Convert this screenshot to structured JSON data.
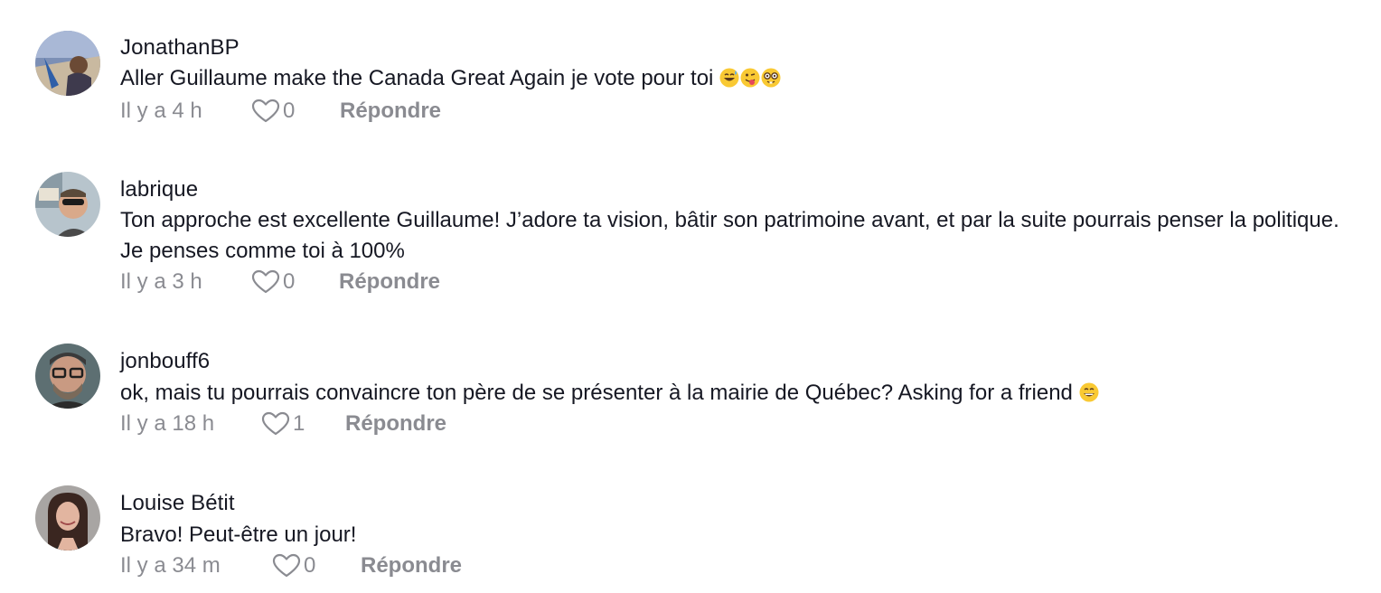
{
  "reply_label": "Répondre",
  "comments": [
    {
      "username": "JonathanBP",
      "text": "Aller Guillaume make the Canada Great Again je vote pour toi",
      "emojis": [
        "grinning-sweat-emoji",
        "winking-tongue-emoji",
        "nerd-glasses-emoji"
      ],
      "time": "Il y a 4 h",
      "likes": "0"
    },
    {
      "username": "labrique",
      "text": "Ton approche est excellente Guillaume! J’adore ta vision, bâtir son patrimoine avant, et par la suite pourrais penser la politique. Je penses comme toi à 100%",
      "time": "Il y a 3 h",
      "likes": "0"
    },
    {
      "username": "jonbouff6",
      "text": "ok, mais tu pourrais convaincre ton père de se présenter à la mairie de Québec? Asking for a friend",
      "emojis": [
        "grinning-emoji"
      ],
      "time": "Il y a 18 h",
      "likes": "1"
    },
    {
      "username": "Louise Bétit",
      "text": "Bravo! Peut-être un jour!",
      "time": "Il y a 34 m",
      "likes": "0"
    }
  ]
}
